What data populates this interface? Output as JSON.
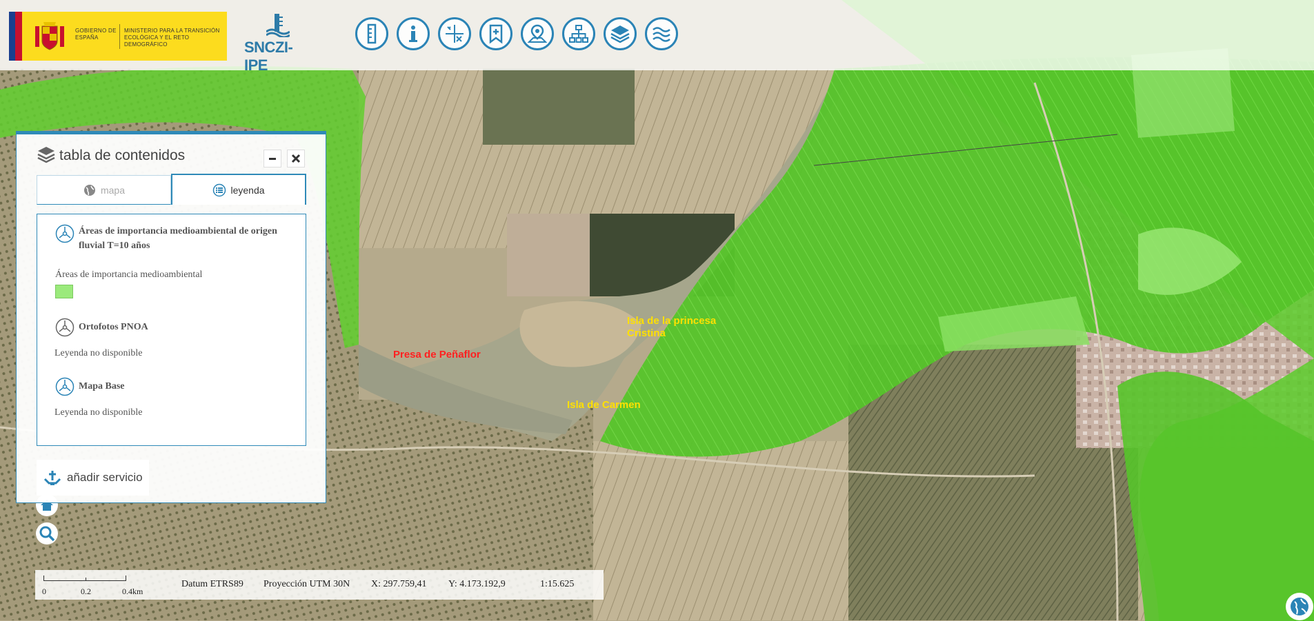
{
  "header": {
    "gov_text": "GOBIERNO DE ESPAÑA",
    "ministry_text": "MINISTERIO PARA LA TRANSICIÓN ECOLÓGICA Y EL RETO DEMOGRÁFICO",
    "app_logo": "SNCZI-IPE"
  },
  "toolbar": [
    {
      "icon": "ruler-icon"
    },
    {
      "icon": "info-icon"
    },
    {
      "icon": "coordinates-icon"
    },
    {
      "icon": "bookmark-icon"
    },
    {
      "icon": "map-pin-icon"
    },
    {
      "icon": "hierarchy-icon"
    },
    {
      "icon": "layers-icon"
    },
    {
      "icon": "water-waves-icon"
    }
  ],
  "toc": {
    "title": "tabla de contenidos",
    "tabs": [
      {
        "label": "mapa",
        "active": false
      },
      {
        "label": "leyenda",
        "active": true
      }
    ],
    "legend": [
      {
        "title": "Áreas de importancia medioambiental de origen fluvial T=10 años",
        "item_label": "Áreas de importancia medioambiental",
        "swatch_color": "#9bea7c"
      },
      {
        "title": "Ortofotos PNOA",
        "note": "Leyenda no disponible"
      },
      {
        "title": "Mapa Base",
        "note": "Leyenda no disponible"
      }
    ],
    "add_service": "añadir servicio"
  },
  "map_labels": [
    {
      "text": "Presa de Peñaflor",
      "color": "red"
    },
    {
      "text": "Isla de la princesa Cristina",
      "color": "yellow"
    },
    {
      "text": "Isla de Carmen",
      "color": "yellow"
    }
  ],
  "status": {
    "scale_ticks": [
      "0",
      "0.2",
      "0.4km"
    ],
    "datum": "Datum ETRS89",
    "projection": "Proyección UTM 30N",
    "x": "X: 297.759,41",
    "y": "Y: 4.173.192,9",
    "scale": "1:15.625"
  },
  "colors": {
    "accent": "#2b84b6",
    "flood_zone": "#5ecf2e"
  }
}
